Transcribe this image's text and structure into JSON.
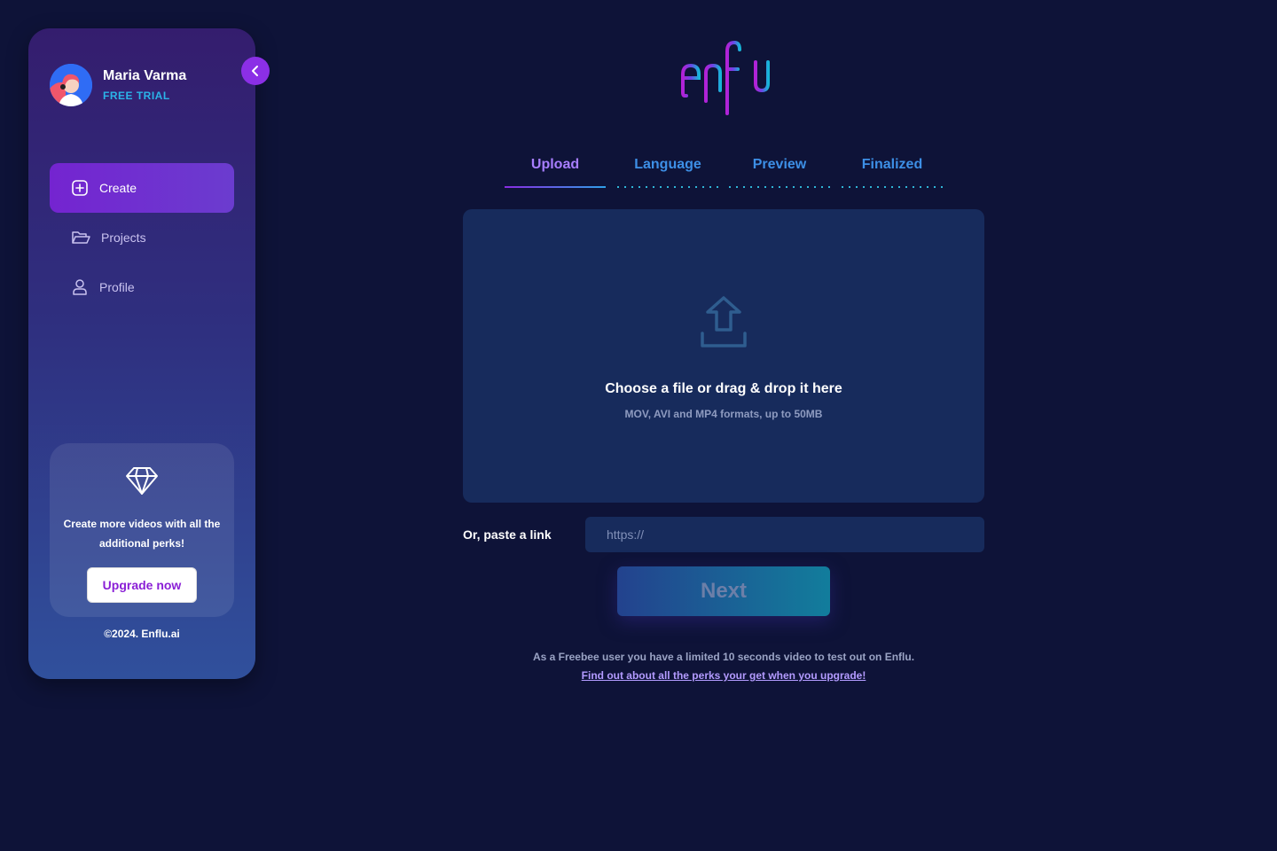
{
  "user": {
    "name": "Maria Varma",
    "plan": "FREE TRIAL"
  },
  "sidebar": {
    "items": [
      {
        "label": "Create",
        "icon": "plus-square-icon",
        "active": true
      },
      {
        "label": "Projects",
        "icon": "folder-open-icon",
        "active": false
      },
      {
        "label": "Profile",
        "icon": "user-icon",
        "active": false
      }
    ],
    "promo": {
      "icon": "diamond-icon",
      "text": "Create more videos with all the additional perks!",
      "button": "Upgrade now"
    },
    "copyright": "©2024. Enflu.ai"
  },
  "brand": {
    "logo_text": "enflu",
    "colors": {
      "primary": "#8b2fe6",
      "accent": "#2fa0e8",
      "background": "#0e1338"
    }
  },
  "steps": [
    {
      "label": "Upload",
      "state": "active"
    },
    {
      "label": "Language",
      "state": "pending"
    },
    {
      "label": "Preview",
      "state": "pending"
    },
    {
      "label": "Finalized",
      "state": "pending"
    }
  ],
  "upload": {
    "icon": "upload-icon",
    "title": "Choose a file or drag & drop it here",
    "subtitle": "MOV, AVI and MP4 formats, up to 50MB"
  },
  "link": {
    "label": "Or, paste a link",
    "placeholder": "https://",
    "value": ""
  },
  "next_button": "Next",
  "footer": {
    "note": "As a Freebee user you have a limited 10 seconds video to test out on Enflu.",
    "link": "Find out about all the perks your get when you upgrade!"
  }
}
